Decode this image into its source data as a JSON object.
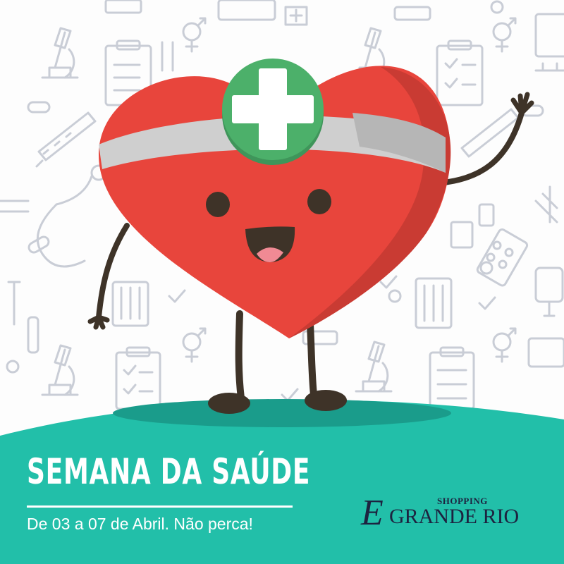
{
  "banner": {
    "title": "SEMANA DA SAÚDE",
    "subtitle": "De 03 a 07 de Abril. Não perca!"
  },
  "brand": {
    "initial": "E",
    "small": "SHOPPING",
    "name": "GRANDE RIO"
  },
  "colors": {
    "background": "#fdfdfd",
    "pattern_stroke": "#c9cdd6",
    "teal": "#22bfa9",
    "teal_dark": "#1a9c8b",
    "heart": "#e8453c",
    "heart_shade": "#c93b33",
    "headband": "#cfcfcf",
    "cross_badge": "#4cb06a",
    "limbs": "#3e3328",
    "brand_navy": "#1d2340"
  },
  "icons": [
    "microscope-icon",
    "clipboard-icon",
    "thermometer-icon",
    "pills-icon",
    "stethoscope-icon",
    "test-tubes-icon",
    "syringe-icon",
    "gender-icon",
    "iv-bag-icon",
    "pill-blister-icon",
    "check-icon"
  ]
}
